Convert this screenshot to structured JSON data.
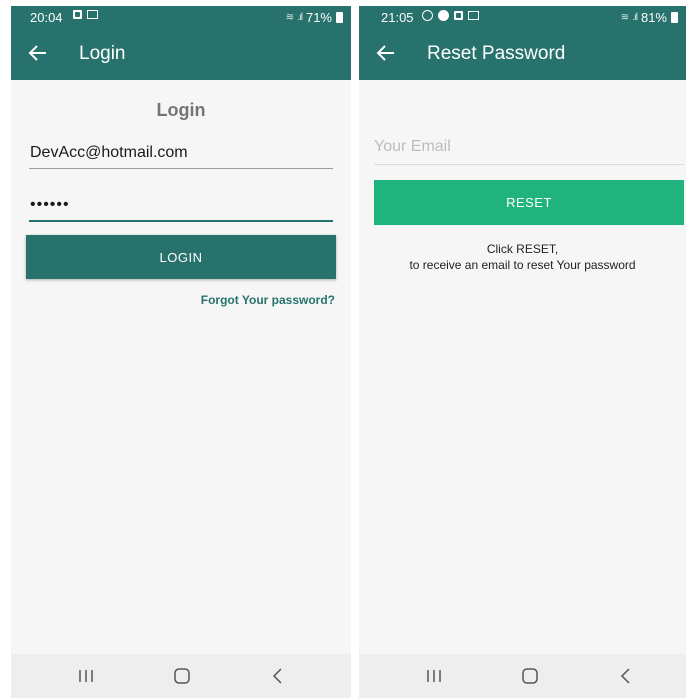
{
  "login_screen": {
    "status": {
      "time": "20:04",
      "battery": "71%"
    },
    "app_bar": {
      "title": "Login"
    },
    "form": {
      "heading": "Login",
      "email_value": "DevAcc@hotmail.com",
      "password_value": "••••••",
      "login_label": "LOGIN",
      "forgot_label": "Forgot Your password?"
    }
  },
  "reset_screen": {
    "status": {
      "time": "21:05",
      "battery": "81%"
    },
    "app_bar": {
      "title": "Reset Password"
    },
    "form": {
      "email_placeholder": "Your Email",
      "reset_label": "RESET",
      "hint_line1": "Click RESET,",
      "hint_line2": "to receive an email to reset Your password"
    }
  },
  "colors": {
    "primary": "#27726c",
    "accent": "#20b37d",
    "background": "#f6f6f6"
  },
  "icons": [
    "back-arrow-icon",
    "recent-apps-icon",
    "home-icon",
    "nav-back-icon",
    "wifi-icon",
    "signal-icon",
    "battery-icon"
  ]
}
